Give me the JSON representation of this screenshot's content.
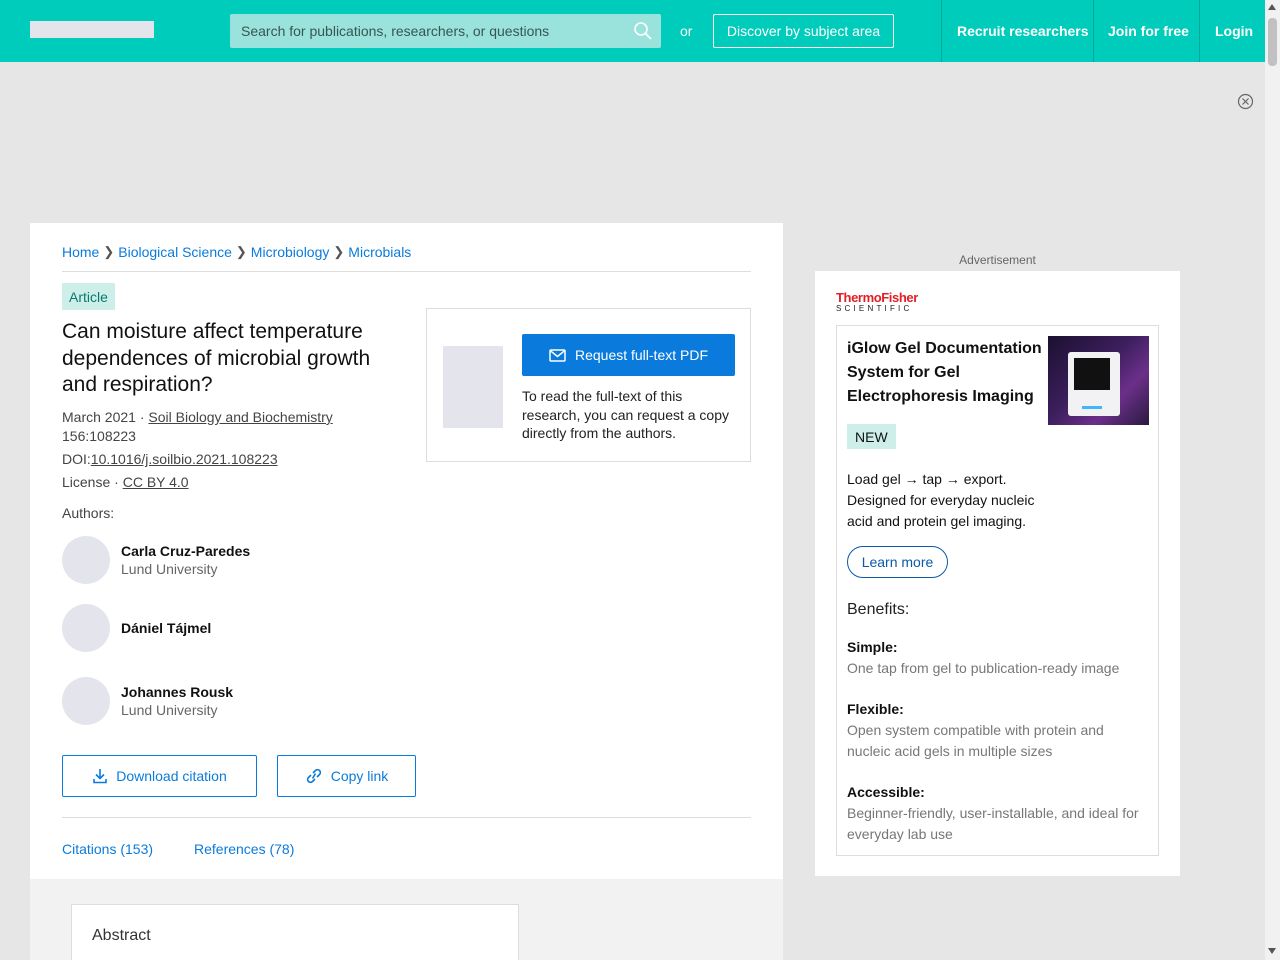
{
  "header": {
    "search_placeholder": "Search for publications, researchers, or questions",
    "or_text": "or",
    "discover_label": "Discover by subject area",
    "nav": [
      "Recruit researchers",
      "Join for free",
      "Login"
    ],
    "accent_color": "#00ccbb"
  },
  "breadcrumb": [
    "Home",
    "Biological Science",
    "Microbiology",
    "Microbials"
  ],
  "article": {
    "type_badge": "Article",
    "title": "Can moisture affect temperature dependences of microbial growth and respiration?",
    "date": "March 2021",
    "dot": "·",
    "journal": "Soil Biology and Biochemistry",
    "volume": "156:108223",
    "doi_prefix": "DOI:",
    "doi": "10.1016/j.soilbio.2021.108223",
    "license_prefix": "License ·",
    "license": "CC BY 4.0",
    "authors_label": "Authors:",
    "authors": [
      {
        "name": "Carla Cruz-Paredes",
        "affiliation": "Lund University"
      },
      {
        "name": "Dániel Tájmel",
        "affiliation": ""
      },
      {
        "name": "Johannes Rousk",
        "affiliation": "Lund University"
      }
    ],
    "download_citation": "Download citation",
    "copy_link": "Copy link",
    "tabs": [
      "Citations (153)",
      "References (78)"
    ],
    "abstract_heading": "Abstract"
  },
  "request": {
    "button_label": "Request full-text PDF",
    "text": "To read the full-text of this research, you can request a copy directly from the authors."
  },
  "ad": {
    "label": "Advertisement",
    "brand_line1": "ThermoFisher",
    "brand_line2": "SCIENTIFIC",
    "title": "iGlow Gel Documentation System for Gel Electrophoresis Imaging",
    "badge": "NEW",
    "description": "Load gel → tap → export. Designed for everyday nucleic acid and protein gel imaging.",
    "learn_more": "Learn more",
    "benefits_heading": "Benefits:",
    "benefits": [
      {
        "title": "Simple:",
        "text": "One tap from gel to publication-ready image"
      },
      {
        "title": "Flexible:",
        "text": "Open system compatible with protein and nucleic acid gels in multiple sizes"
      },
      {
        "title": "Accessible:",
        "text": "Beginner-friendly, user-installable, and ideal for everyday lab use"
      }
    ]
  }
}
